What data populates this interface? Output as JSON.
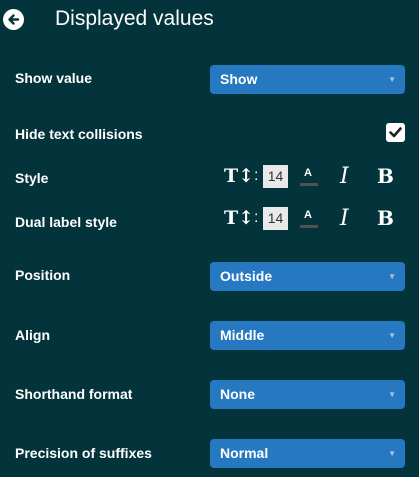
{
  "header": {
    "title": "Displayed values",
    "back_icon": "arrow-left-circle-icon"
  },
  "rows": {
    "show_value": {
      "label": "Show value",
      "value": "Show"
    },
    "hide_text_collisions": {
      "label": "Hide text collisions",
      "checked": true
    },
    "style": {
      "label": "Style",
      "font_size": "14",
      "color_letter": "A",
      "italic": "I",
      "bold": "B"
    },
    "dual_label_style": {
      "label": "Dual label style",
      "font_size": "14",
      "color_letter": "A",
      "italic": "I",
      "bold": "B"
    },
    "position": {
      "label": "Position",
      "value": "Outside"
    },
    "align": {
      "label": "Align",
      "value": "Middle"
    },
    "shorthand_format": {
      "label": "Shorthand format",
      "value": "None"
    },
    "precision_of_suffixes": {
      "label": "Precision of suffixes",
      "value": "Normal"
    }
  },
  "icons": {
    "caret": "▼",
    "text_size": "T↕",
    "checkmark": "checkmark-icon"
  },
  "colors": {
    "background": "#03343b",
    "select": "#2678c0",
    "color_swatch": "#515151"
  }
}
